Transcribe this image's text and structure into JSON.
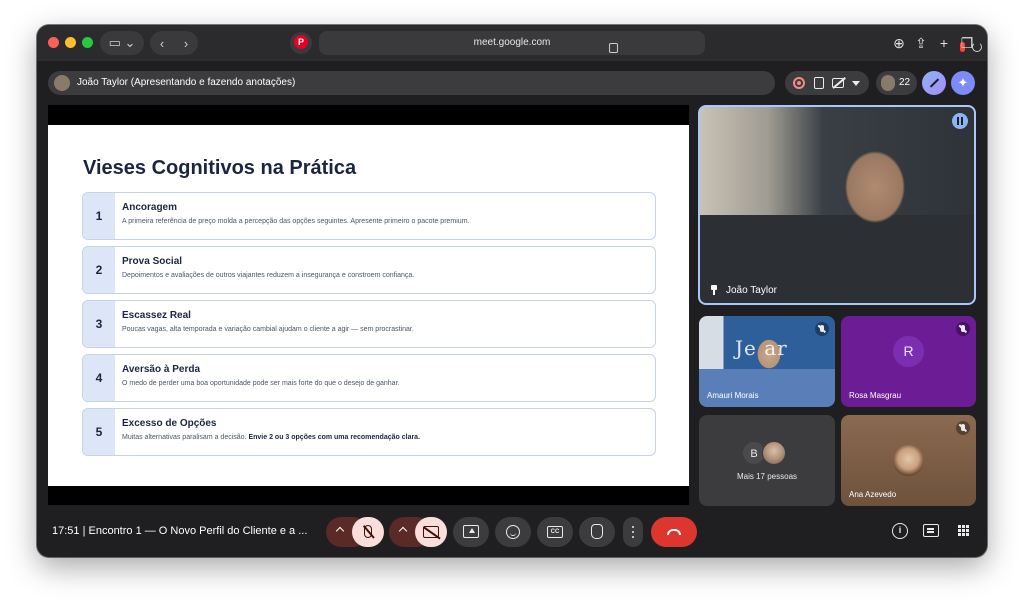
{
  "browser": {
    "url": "meet.google.com"
  },
  "meet": {
    "presenter_label": "João Taylor (Apresentando e fazendo anotações)",
    "participant_count": "22"
  },
  "slide": {
    "title": "Vieses Cognitivos na Prática",
    "items": [
      {
        "num": "1",
        "head": "Ancoragem",
        "desc": "A primeira referência de preço molda a percepção das opções seguintes. Apresente primeiro o pacote premium.",
        "desc_bold": ""
      },
      {
        "num": "2",
        "head": "Prova Social",
        "desc": "Depoimentos e avaliações de outros viajantes reduzem a insegurança e constroem confiança.",
        "desc_bold": ""
      },
      {
        "num": "3",
        "head": "Escassez Real",
        "desc": "Poucas vagas, alta temporada e variação cambial ajudam o cliente a agir — sem procrastinar.",
        "desc_bold": ""
      },
      {
        "num": "4",
        "head": "Aversão à Perda",
        "desc": "O medo de perder uma boa oportunidade pode ser mais forte do que o desejo de ganhar.",
        "desc_bold": ""
      },
      {
        "num": "5",
        "head": "Excesso de Opções",
        "desc": "Muitas alternativas paralisam a decisão. ",
        "desc_bold": "Envie 2 ou 3 opções com uma recomendação clara."
      }
    ]
  },
  "participants": {
    "main": "João Taylor",
    "tile_1": "Amauri Morais",
    "tile_1_sign": "Je   ar",
    "tile_2": "Rosa Masgrau",
    "tile_2_initial": "R",
    "more_initial": "B",
    "more_label": "Mais 17 pessoas",
    "tile_4": "Ana Azevedo"
  },
  "bottom": {
    "meeting_info": "17:51  |  Encontro 1 — O Novo Perfil do Cliente e a ...",
    "cc_label": "CC",
    "info_label": "i"
  },
  "colors": {
    "window_bg": "#1f1f21",
    "end_call": "#dc362e",
    "slide_title": "#1b2540",
    "active_speaker_border": "#a8c7fa"
  }
}
